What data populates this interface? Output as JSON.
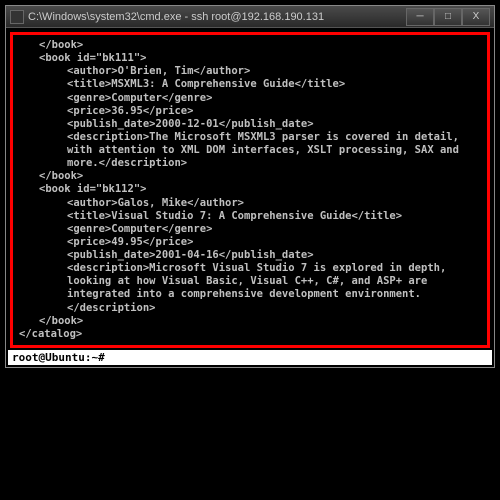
{
  "window": {
    "title": "C:\\Windows\\system32\\cmd.exe - ssh  root@192.168.190.131",
    "minimize": "─",
    "maximize": "□",
    "close": "X"
  },
  "xml": {
    "close_book_top": "</book>",
    "book1_open": "<book id=\"bk111\">",
    "book1_author": "<author>O'Brien, Tim</author>",
    "book1_title": "<title>MSXML3: A Comprehensive Guide</title>",
    "book1_genre": "<genre>Computer</genre>",
    "book1_price": "<price>36.95</price>",
    "book1_date": "<publish_date>2000-12-01</publish_date>",
    "book1_desc": "<description>The Microsoft MSXML3 parser is covered in detail, with attention to XML DOM interfaces, XSLT processing, SAX and more.</description>",
    "book1_close": "</book>",
    "book2_open": "<book id=\"bk112\">",
    "book2_author": "<author>Galos, Mike</author>",
    "book2_title": "<title>Visual Studio 7: A Comprehensive Guide</title>",
    "book2_genre": "<genre>Computer</genre>",
    "book2_price": "<price>49.95</price>",
    "book2_date": "<publish_date>2001-04-16</publish_date>",
    "book2_desc": "<description>Microsoft Visual Studio 7 is explored in depth, looking at how Visual Basic, Visual C++, C#, and ASP+ are integrated into a comprehensive development environment.</description>",
    "book2_close": "</book>",
    "catalog_close": "</catalog>"
  },
  "prompt": "root@Ubuntu:~#"
}
